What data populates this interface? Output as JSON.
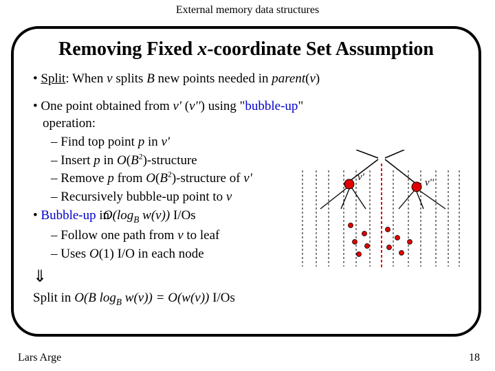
{
  "header": "External memory data structures",
  "title_pre": "Removing Fixed ",
  "title_x": "x",
  "title_post": "-coordinate Set Assumption",
  "bullets": {
    "split_label": "Split",
    "split_rest1": ": When ",
    "v": "v",
    "split_rest2": " splits ",
    "B": "B",
    "split_rest3": " new points needed in ",
    "parent": "parent",
    "split_rest4": "(",
    "split_rest5": ")",
    "b2_lead": "One point obtained from ",
    "vp": "v'",
    "b2_mid": " (",
    "vpp": "v''",
    "b2_mid2": ") using \"",
    "bubbleup": "bubble-up",
    "b2_end": "\" operation:",
    "s1a": "Find top point ",
    "p": "p",
    "s1b": " in ",
    "s2a": "Insert ",
    "s2b": " in ",
    "O": "O",
    "Bsq": "B",
    "two": "2",
    "s2c": ")-structure",
    "s3a": "Remove ",
    "s3b": " from ",
    "s3c": ")-structure of ",
    "s4": "Recursively bubble-up point to ",
    "b3_lead": "Bubble-up",
    "b3_in": " in ",
    "formula1_a": "O",
    "formula1_b": "(log",
    "formula1_sub": "B",
    "formula1_c": " w",
    "formula1_d": "(",
    "formula1_e": "))",
    "ios": " I/Os",
    "s5a": "Follow one path from ",
    "s5b": " to leaf",
    "s6a": "Uses ",
    "s6b": "(1)",
    "s6c": " I/O in each node",
    "arrow": "⇓",
    "final_a": "Split in ",
    "formula2": "O(B log_B w(v)) = O(w(v))",
    "final_b": " I/Os"
  },
  "diagram": {
    "label_vp": "v'",
    "label_vpp": "v''"
  },
  "footer": {
    "author": "Lars Arge",
    "page": "18"
  }
}
